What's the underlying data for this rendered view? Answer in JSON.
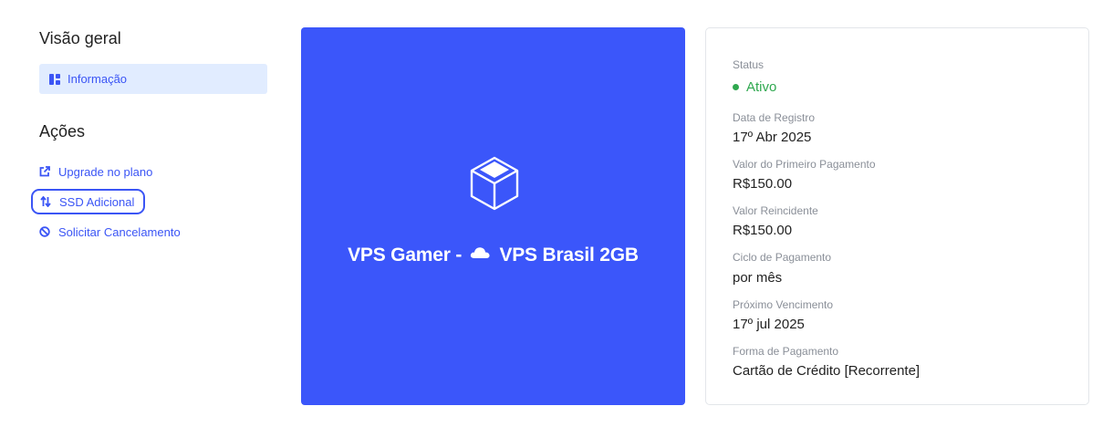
{
  "sidebar": {
    "overview_title": "Visão geral",
    "info_label": "Informação",
    "actions_title": "Ações",
    "actions": [
      {
        "label": "Upgrade no plano",
        "icon": "external-link-icon"
      },
      {
        "label": "SSD Adicional",
        "icon": "swap-vertical-icon"
      },
      {
        "label": "Solicitar Cancelamento",
        "icon": "ban-icon"
      }
    ]
  },
  "product": {
    "title_prefix": "VPS Gamer -",
    "title_suffix": "VPS Brasil 2GB",
    "icon": "cube-icon",
    "background_color": "#3b56fa"
  },
  "details": {
    "status_label": "Status",
    "status_value": "Ativo",
    "status_color": "#2fa84f",
    "registration_label": "Data de Registro",
    "registration_value": "17º Abr 2025",
    "first_payment_label": "Valor do Primeiro Pagamento",
    "first_payment_value": "R$150.00",
    "recurring_label": "Valor Reincidente",
    "recurring_value": "R$150.00",
    "cycle_label": "Ciclo de Pagamento",
    "cycle_value": "por mês",
    "next_due_label": "Próximo Vencimento",
    "next_due_value": "17º jul 2025",
    "payment_method_label": "Forma de Pagamento",
    "payment_method_value": "Cartão de Crédito [Recorrente]"
  },
  "accent_color": "#3b55f5"
}
